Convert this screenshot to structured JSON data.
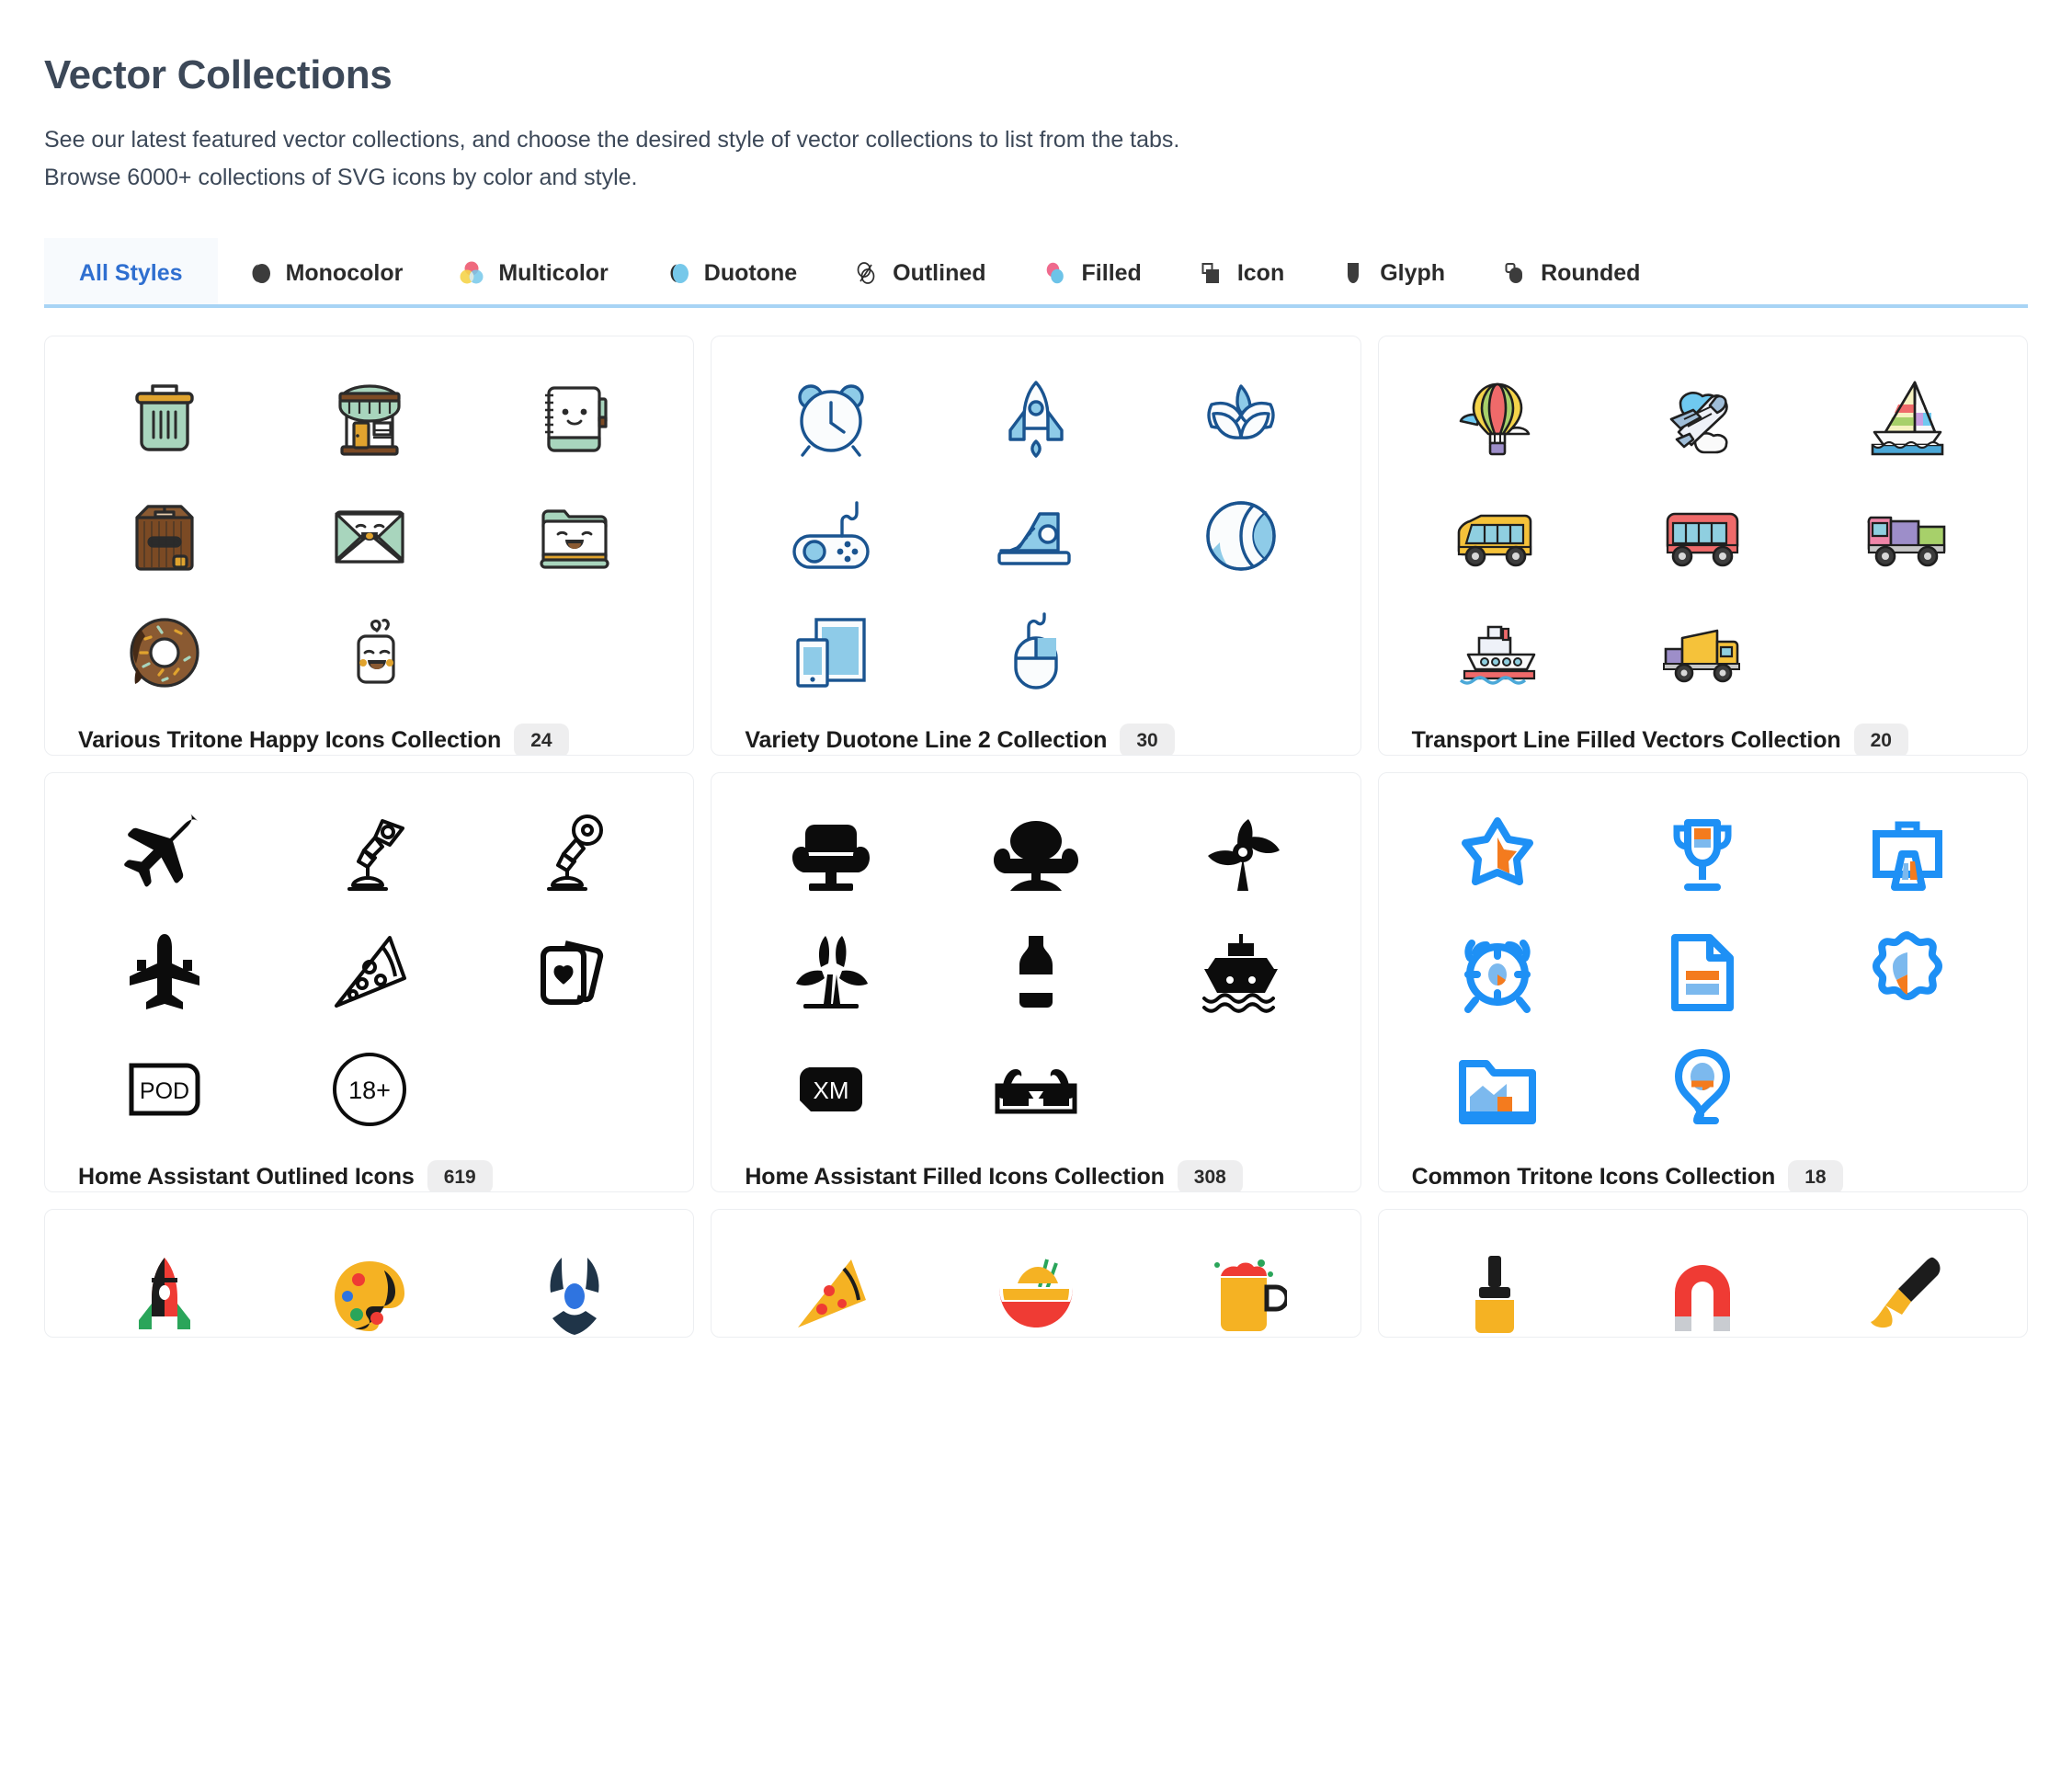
{
  "header": {
    "title": "Vector Collections",
    "subtitle_line1": "See our latest featured vector collections, and choose the desired style of vector collections to list from the tabs.",
    "subtitle_line2": "Browse 6000+ collections of SVG icons by color and style."
  },
  "tabs": [
    {
      "label": "All Styles",
      "icon": "none",
      "active": true
    },
    {
      "label": "Monocolor",
      "icon": "monocolor-style-icon",
      "active": false
    },
    {
      "label": "Multicolor",
      "icon": "multicolor-style-icon",
      "active": false
    },
    {
      "label": "Duotone",
      "icon": "duotone-style-icon",
      "active": false
    },
    {
      "label": "Outlined",
      "icon": "outlined-style-icon",
      "active": false
    },
    {
      "label": "Filled",
      "icon": "filled-style-icon",
      "active": false
    },
    {
      "label": "Icon",
      "icon": "icon-style-icon",
      "active": false
    },
    {
      "label": "Glyph",
      "icon": "glyph-style-icon",
      "active": false
    },
    {
      "label": "Rounded",
      "icon": "rounded-style-icon",
      "active": false
    }
  ],
  "colors": {
    "accent_blue": "#2f6fd0",
    "tab_underline": "#a8d4f5",
    "badge_bg": "#eeeeef",
    "title_text": "#3c4858",
    "tritone_mint": "#a8d5bd",
    "tritone_gold": "#e0a32e",
    "tritone_brown": "#7b4a24",
    "duotone_dark": "#1a5490",
    "duotone_light": "#8ecbe8",
    "tritone_blue": "#1e90f5",
    "tritone_orange": "#f47b1e"
  },
  "collections": [
    {
      "title": "Various Tritone Happy Icons Collection",
      "count": "24",
      "icons": [
        "trash-can-icon",
        "storefront-icon",
        "notebook-face-icon",
        "cardboard-box-icon",
        "envelope-face-icon",
        "folder-face-icon",
        "donut-icon",
        "coffee-mug-face-icon"
      ]
    },
    {
      "title": "Variety Duotone Line 2 Collection",
      "count": "30",
      "icons": [
        "alarm-clock-icon",
        "rocket-icon",
        "lotus-flower-icon",
        "game-controller-icon",
        "sneaker-icon",
        "ball-icon",
        "tablet-phone-icon",
        "computer-mouse-icon"
      ]
    },
    {
      "title": "Transport Line Filled Vectors Collection",
      "count": "20",
      "icons": [
        "hot-air-balloon-icon",
        "airplane-cloud-icon",
        "sailboat-icon",
        "school-bus-icon",
        "red-bus-icon",
        "pink-truck-icon",
        "cruise-ship-icon",
        "dump-truck-icon"
      ]
    },
    {
      "title": "Home Assistant Outlined Icons",
      "count": "619",
      "icons": [
        "airplane-tilted-icon",
        "desk-lamp-icon",
        "desk-lamp-round-icon",
        "airplane-top-icon",
        "pizza-slice-icon",
        "playing-cards-icon",
        "pod-badge-icon",
        "age-18-plus-icon"
      ]
    },
    {
      "title": "Home Assistant Filled Icons Collection",
      "count": "308",
      "icons": [
        "armchair-icon",
        "armchair-round-icon",
        "propeller-icon",
        "wind-turbine-icon",
        "bottle-icon",
        "ship-front-icon",
        "xm-badge-icon",
        "3d-glasses-icon"
      ]
    },
    {
      "title": "Common Tritone Icons Collection",
      "count": "18",
      "icons": [
        "star-badge-icon",
        "trophy-icon",
        "briefcase-chart-icon",
        "alarm-target-icon",
        "document-chart-icon",
        "seal-chart-icon",
        "folder-chart-icon",
        "location-pin-icon"
      ]
    },
    {
      "title": "",
      "count": "",
      "icons": [
        "rocket-flat-icon",
        "paint-palette-icon",
        "radiation-icon"
      ]
    },
    {
      "title": "",
      "count": "",
      "icons": [
        "pizza-flat-icon",
        "noodle-bowl-icon",
        "beer-mug-icon"
      ]
    },
    {
      "title": "",
      "count": "",
      "icons": [
        "paint-roller-icon",
        "magnet-icon",
        "paint-brush-icon"
      ]
    }
  ]
}
